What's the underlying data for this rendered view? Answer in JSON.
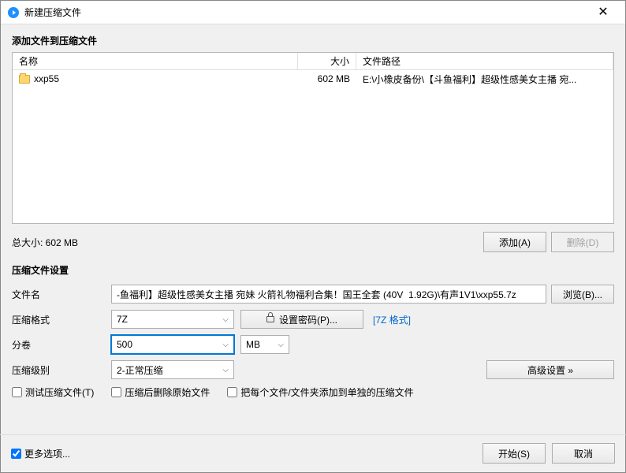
{
  "titlebar": {
    "title": "新建压缩文件",
    "close": "✕"
  },
  "section1": {
    "header": "添加文件到压缩文件",
    "columns": {
      "name": "名称",
      "size": "大小",
      "path": "文件路径"
    },
    "rows": [
      {
        "name": "xxp55",
        "size": "602 MB",
        "path": "E:\\小橡皮备份\\【斗鱼福利】超级性感美女主播 宛..."
      }
    ],
    "total": "总大小: 602 MB",
    "add": "添加(A)",
    "delete": "删除(D)"
  },
  "section2": {
    "header": "压缩文件设置",
    "filename_label": "文件名",
    "filename_value": "-鱼福利】超级性感美女主播 宛妹 火箭礼物福利合集！国王全套 (40V  1.92G)\\有声1V1\\xxp55.7z",
    "browse": "浏览(B)...",
    "format_label": "压缩格式",
    "format_value": "7Z",
    "password": "设置密码(P)...",
    "format_link": "[7Z 格式]",
    "volume_label": "分卷",
    "volume_value": "500",
    "unit_value": "MB",
    "level_label": "压缩级别",
    "level_value": "2-正常压缩",
    "advanced": "高级设置 »",
    "test_label": "测试压缩文件(T)",
    "delete_after_label": "压缩后删除原始文件",
    "separate_label": "把每个文件/文件夹添加到单独的压缩文件"
  },
  "bottom": {
    "more": "更多选项...",
    "start": "开始(S)",
    "cancel": "取消"
  }
}
